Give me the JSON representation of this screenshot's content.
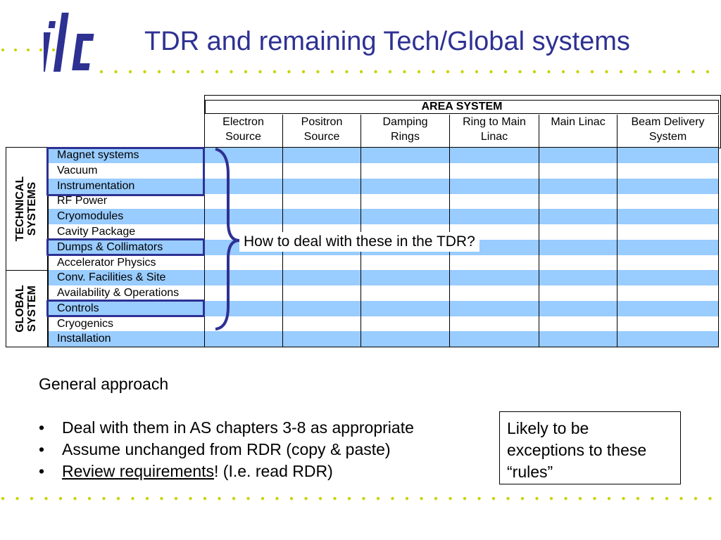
{
  "slide": {
    "title": "TDR and remaining Tech/Global systems",
    "accent_color": "#2e3192",
    "band_color": "#99ccff",
    "dot_color": "#c8d400",
    "logo_icon": "ilc-logo"
  },
  "table": {
    "area_header": "AREA SYSTEM",
    "columns": [
      {
        "line1": "Electron",
        "line2": "Source"
      },
      {
        "line1": "Positron",
        "line2": "Source"
      },
      {
        "line1": "Damping",
        "line2": "Rings"
      },
      {
        "line1": "Ring to Main",
        "line2": "Linac"
      },
      {
        "line1": "Main Linac",
        "line2": ""
      },
      {
        "line1": "Beam Delivery",
        "line2": "System"
      }
    ],
    "technical_label": {
      "line1": "TECHNICAL",
      "line2": "SYSTEMS"
    },
    "global_label": {
      "line1": "GLOBAL",
      "line2": "SYSTEM"
    },
    "rows": [
      "Magnet systems",
      "Vacuum",
      "Instrumentation",
      "RF Power",
      "Cryomodules",
      "Cavity Package",
      "Dumps & Collimators",
      "Accelerator Physics",
      "Conv. Facilities & Site",
      "Availability & Operations",
      "Controls",
      "Cryogenics",
      "Installation"
    ]
  },
  "callout": "How to deal with these in the TDR?",
  "approach": {
    "heading": "General approach",
    "bullet_char": "•",
    "items": [
      {
        "text": "Deal with them in AS chapters 3-8 as appropriate"
      },
      {
        "text": "Assume unchanged from RDR (copy & paste)"
      },
      {
        "underlined": "Review requirements",
        "rest": "! (I.e. read RDR)"
      }
    ]
  },
  "note_box": {
    "line1": "Likely to be",
    "line2": "exceptions to these",
    "line3": "“rules”"
  }
}
